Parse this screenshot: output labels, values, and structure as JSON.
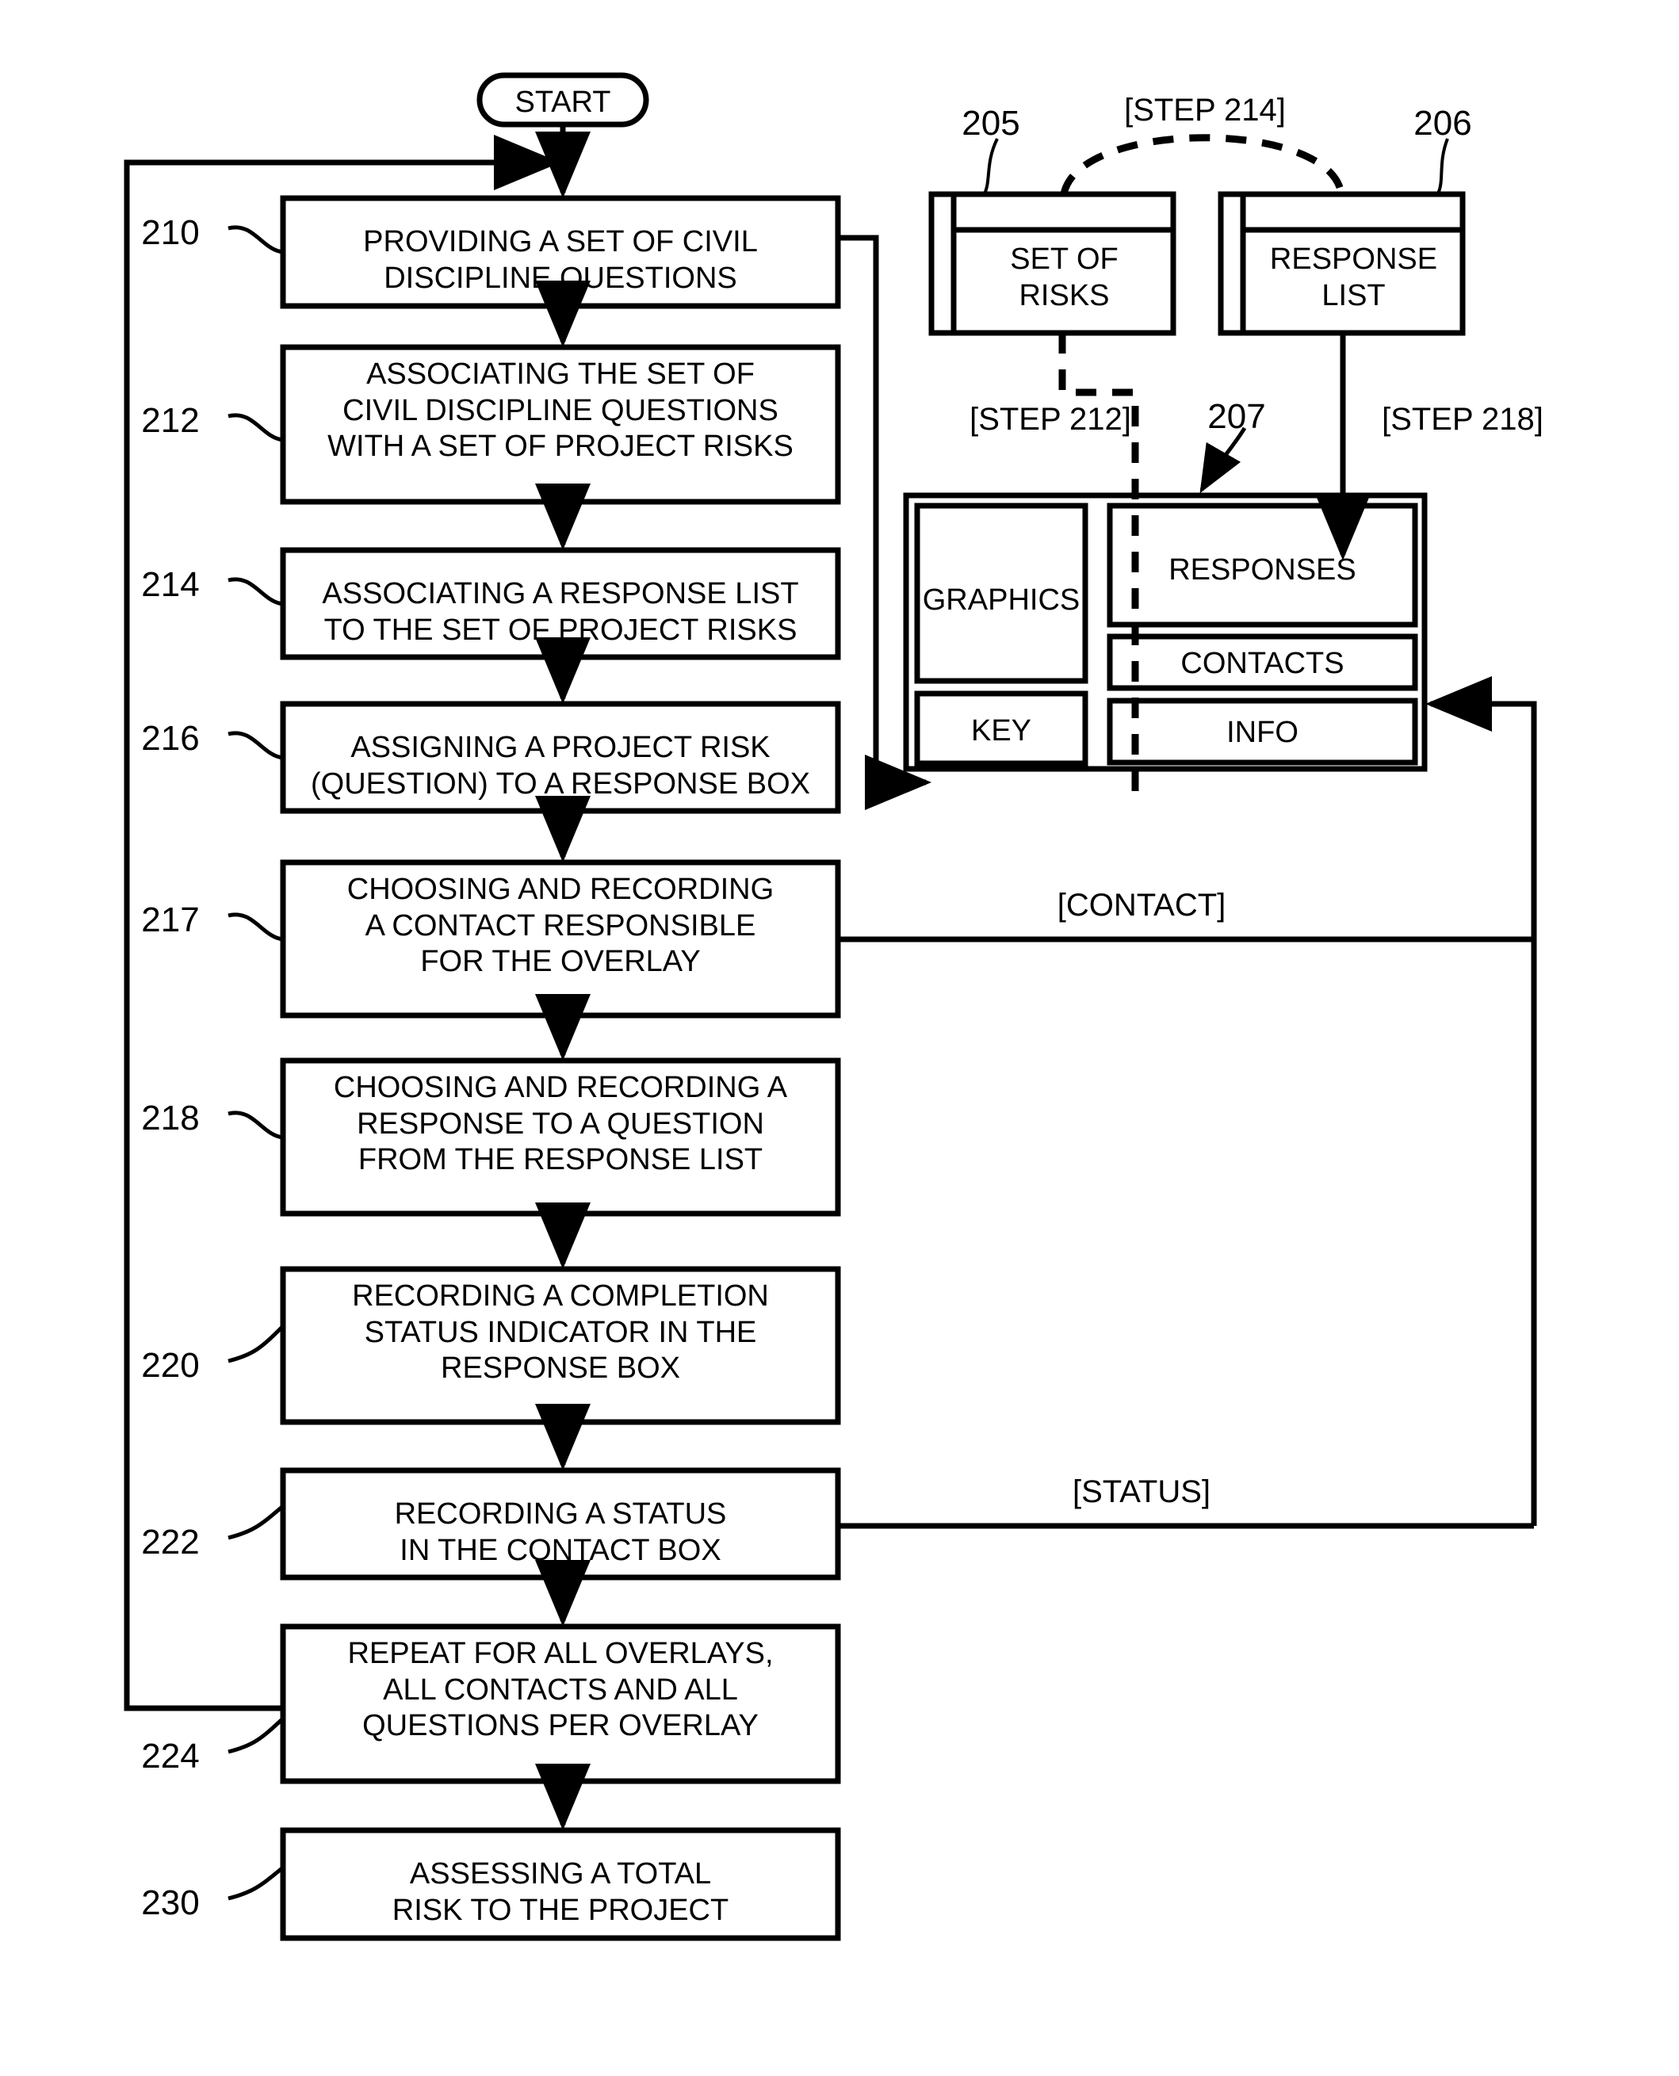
{
  "figure": {
    "type": "patent-flowchart",
    "start_label": "START"
  },
  "flow_steps": [
    {
      "ref": "210",
      "text": "PROVIDING A SET OF CIVIL\nDISCIPLINE QUESTIONS"
    },
    {
      "ref": "212",
      "text": "ASSOCIATING THE SET OF\nCIVIL DISCIPLINE QUESTIONS\nWITH A SET OF PROJECT RISKS"
    },
    {
      "ref": "214",
      "text": "ASSOCIATING A RESPONSE LIST\nTO THE SET OF PROJECT RISKS"
    },
    {
      "ref": "216",
      "text": "ASSIGNING A PROJECT RISK\n(QUESTION) TO A RESPONSE BOX"
    },
    {
      "ref": "217",
      "text": "CHOOSING AND RECORDING\nA CONTACT RESPONSIBLE\nFOR THE OVERLAY"
    },
    {
      "ref": "218",
      "text": "CHOOSING AND RECORDING A\nRESPONSE TO A QUESTION\nFROM THE RESPONSE LIST"
    },
    {
      "ref": "220",
      "text": "RECORDING A COMPLETION\nSTATUS INDICATOR IN THE\nRESPONSE BOX"
    },
    {
      "ref": "222",
      "text": "RECORDING A STATUS\nIN THE CONTACT BOX"
    },
    {
      "ref": "224",
      "text": "REPEAT FOR ALL OVERLAYS,\nALL CONTACTS AND ALL\nQUESTIONS PER OVERLAY"
    },
    {
      "ref": "230",
      "text": "ASSESSING A TOTAL\nRISK TO THE PROJECT"
    }
  ],
  "data_windows": [
    {
      "ref": "205",
      "title": "SET OF\nRISKS"
    },
    {
      "ref": "206",
      "title": "RESPONSE\nLIST"
    }
  ],
  "ui_panel": {
    "ref": "207",
    "regions": [
      {
        "name": "GRAPHICS"
      },
      {
        "name": "KEY"
      },
      {
        "name": "RESPONSES"
      },
      {
        "name": "CONTACTS"
      },
      {
        "name": "INFO"
      }
    ]
  },
  "edge_labels": {
    "step_214": "[STEP 214]",
    "step_212": "[STEP 212]",
    "step_218": "[STEP 218]",
    "contact": "[CONTACT]",
    "status": "[STATUS]"
  }
}
